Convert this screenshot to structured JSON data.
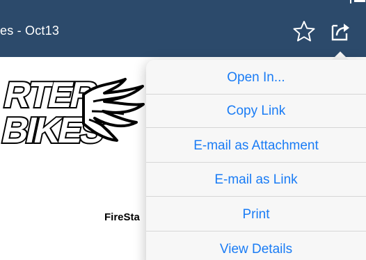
{
  "navbar": {
    "title": "es - Oct13",
    "background_color": "#2c4a6b",
    "icons": {
      "bookmark": "star-icon",
      "share": "share-icon"
    }
  },
  "document": {
    "logo_text": "RTER BIKES",
    "body_text_fragment": "FireSta"
  },
  "menu": {
    "accent_color": "#1a7cf5",
    "items": [
      {
        "label": "Open In..."
      },
      {
        "label": "Copy Link"
      },
      {
        "label": "E-mail as Attachment"
      },
      {
        "label": "E-mail as Link"
      },
      {
        "label": "Print"
      },
      {
        "label": "View Details"
      }
    ]
  }
}
